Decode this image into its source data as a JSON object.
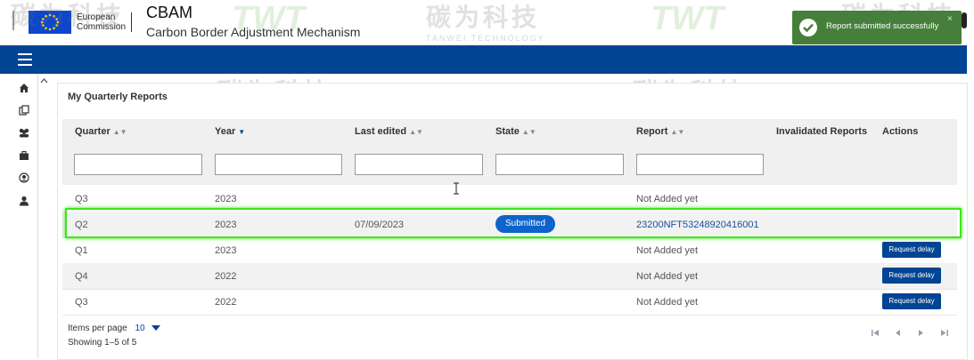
{
  "header": {
    "org_line1": "European",
    "org_line2": "Commission",
    "title": "CBAM",
    "subtitle": "Carbon Border Adjustment Mechanism"
  },
  "card": {
    "title": "My Quarterly Reports"
  },
  "columns": {
    "quarter": "Quarter",
    "year": "Year",
    "last_edited": "Last edited",
    "state": "State",
    "report": "Report",
    "invalidated": "Invalidated Reports",
    "actions": "Actions"
  },
  "rows": [
    {
      "quarter": "Q3",
      "year": "2023",
      "last_edited": "",
      "state": "",
      "report": "Not Added yet",
      "action": ""
    },
    {
      "quarter": "Q2",
      "year": "2023",
      "last_edited": "07/09/2023",
      "state": "Submitted",
      "report": "23200NFT53248920416001",
      "action": ""
    },
    {
      "quarter": "Q1",
      "year": "2023",
      "last_edited": "",
      "state": "",
      "report": "Not Added yet",
      "action": "Request delay"
    },
    {
      "quarter": "Q4",
      "year": "2022",
      "last_edited": "",
      "state": "",
      "report": "Not Added yet",
      "action": "Request delay"
    },
    {
      "quarter": "Q3",
      "year": "2022",
      "last_edited": "",
      "state": "",
      "report": "Not Added yet",
      "action": "Request delay"
    }
  ],
  "pager": {
    "items_label": "Items per page",
    "items_value": "10",
    "showing": "Showing 1–5 of 5"
  },
  "toast": {
    "message": "Report submitted successfully",
    "close": "×"
  },
  "watermark": {
    "cn": "碳为科技",
    "en": "TANWEI TECHNOLOGY",
    "logo": "TWT"
  },
  "colors": {
    "primary": "#004494",
    "badge": "#0e63c9",
    "toast": "#467f3b",
    "highlight": "#3ee51b"
  }
}
